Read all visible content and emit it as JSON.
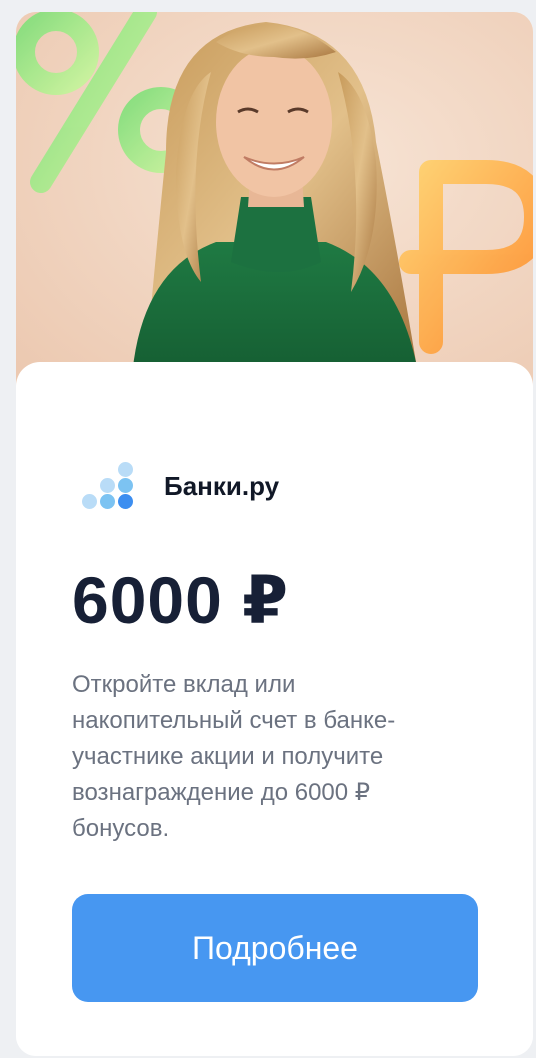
{
  "brand": {
    "name": "Банки.ру",
    "logo_icon": "banki-ru-logo-icon"
  },
  "offer": {
    "amount": "6000 ₽",
    "description": "Откройте вклад или накопительный счет в банке-участнике акции и получите вознаграждение до 6000 ₽ бонусов."
  },
  "cta": {
    "label": "Подробнее"
  },
  "colors": {
    "accent": "#4797f1",
    "title": "#172036",
    "text": "#6b7280",
    "logo_light": "#b9dcf7",
    "logo_mid": "#7cc3f2",
    "logo_dark": "#3c8ef0"
  }
}
